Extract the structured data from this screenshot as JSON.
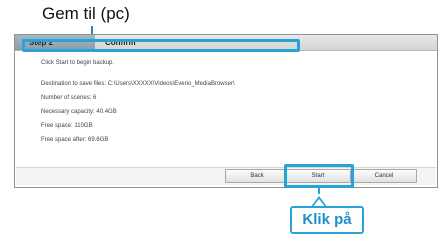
{
  "callouts": {
    "top": "Gem til (pc)",
    "bottom": "Klik på"
  },
  "tabs": {
    "step": "Step 2",
    "confirm": "Confirm"
  },
  "content": {
    "instruction": "Click Start to begin backup.",
    "destination": "Destination to save files: C:\\Users\\XXXXX\\Videos\\Everio_MediaBrowser\\",
    "number_of_scenes": "Number of scenes: 6",
    "necessary_capacity": "Necessary capacity: 40.4GB",
    "free_space": "Free space: 110GB",
    "free_space_after": "Free space after: 69.6GB"
  },
  "buttons": {
    "back": "Back",
    "start": "Start",
    "cancel": "Cancel"
  },
  "colors": {
    "highlight": "#27a3da",
    "header_tab": "#8a9bab",
    "callout_text": "#1d8fcc"
  }
}
